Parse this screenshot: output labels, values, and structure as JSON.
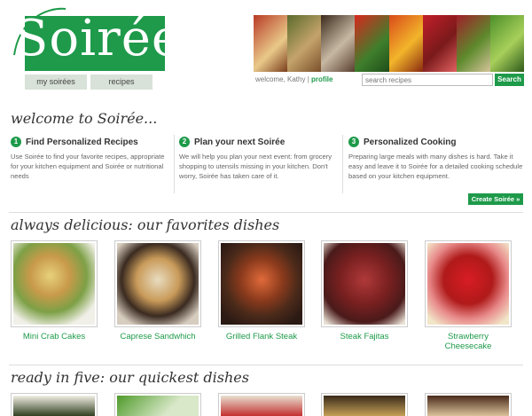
{
  "brand": {
    "logo_text": "Soirée",
    "green": "#1e9a4a"
  },
  "nav": {
    "tabs": [
      {
        "label": "my soirées"
      },
      {
        "label": "recipes"
      }
    ]
  },
  "header": {
    "welcome_text": "welcome, Kathy |",
    "profile_link": "profile",
    "search_placeholder": "search recipes",
    "search_button": "Search",
    "banner_icon": "food-photo-strip"
  },
  "welcome": {
    "title": "welcome to Soirée...",
    "steps": [
      {
        "num": "1",
        "title": "Find Personalized Recipes",
        "body": "Use Soirée to find your favorite recipes, appropriate for your kitchen equipment and Soirée or nutritional needs"
      },
      {
        "num": "2",
        "title": "Plan your next Soirée",
        "body": "We will help you plan your next event: from grocery shopping to utensils missing in your kitchen. Don't worry, Soirée has taken care of it."
      },
      {
        "num": "3",
        "title": "Personalized Cooking",
        "body": "Preparing large meals with many dishes is hard. Take it easy and leave it to Soirée for a detailed cooking schedule based on your kitchen equipment."
      }
    ],
    "create_button": "Create Soirée »"
  },
  "favorites": {
    "title": "always delicious: our favorites dishes",
    "dishes": [
      {
        "name": "Mini Crab Cakes"
      },
      {
        "name": "Caprese Sandwhich"
      },
      {
        "name": "Grilled Flank Steak"
      },
      {
        "name": "Steak Fajitas"
      },
      {
        "name": "Strawberry Cheesecake"
      }
    ]
  },
  "quickest": {
    "title": "ready in five: our quickest dishes"
  }
}
